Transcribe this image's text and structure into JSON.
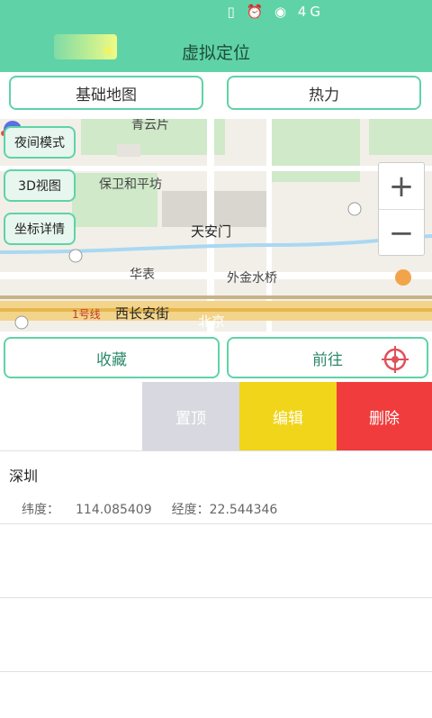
{
  "status_bar": {
    "network": "4G"
  },
  "header": {
    "title": "虚拟定位"
  },
  "tabs": [
    {
      "label": "基础地图"
    },
    {
      "label": "热力"
    }
  ],
  "map": {
    "buttons": {
      "night": "夜间模式",
      "view3d": "3D视图",
      "coords": "坐标详情"
    },
    "zoom": {
      "in": "+",
      "out": "−"
    },
    "labels": {
      "tiananmen": "天安门",
      "baowei": "保卫和平坊",
      "huabiao": "华表",
      "jinshui": "外金水桥",
      "changan": "西长安街",
      "beijing": "北京",
      "line1": "1号线",
      "qingyun": "青云片"
    }
  },
  "actions": {
    "favorite": "收藏",
    "go": "前往"
  },
  "swipe_actions": {
    "pin_top": "置顶",
    "edit": "编辑",
    "delete": "删除"
  },
  "list": [
    {
      "name": "深圳",
      "lat_label": "纬度：",
      "lat": "114.085409",
      "lng_label": "经度：",
      "lng": "22.544346"
    }
  ],
  "colors": {
    "accent": "#5fd3a7",
    "edit": "#f1d51a",
    "delete": "#f03c3c",
    "pin_top": "#d8d8e0"
  }
}
